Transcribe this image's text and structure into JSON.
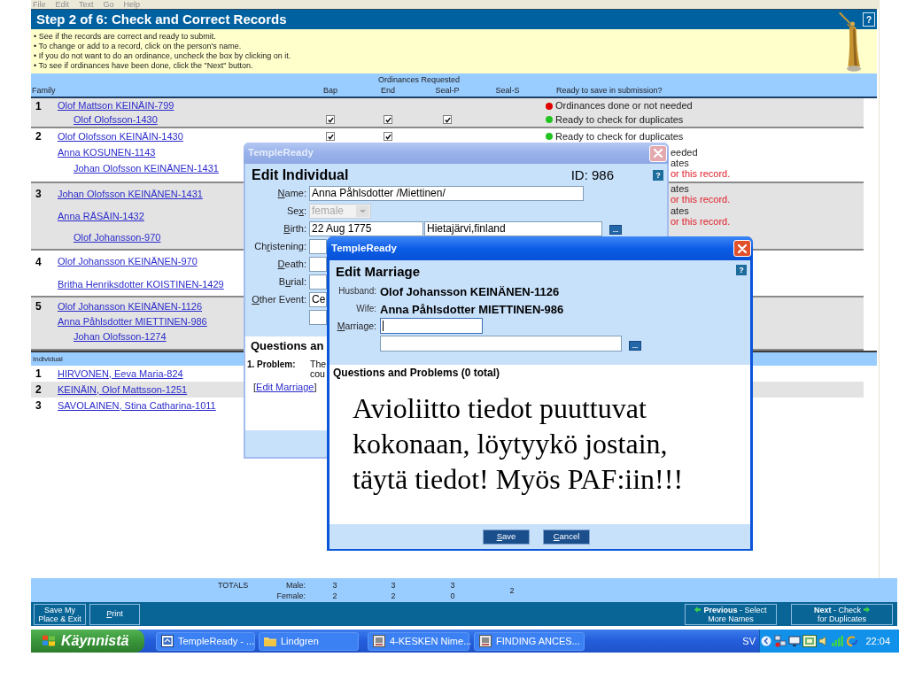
{
  "menu": [
    "File",
    "Edit",
    "Text",
    "Go",
    "Help"
  ],
  "page_header": {
    "title": "Step 2 of 6: Check and Correct Records",
    "help": "?"
  },
  "instructions": [
    "• See if the records are correct and ready to submit.",
    "• To change or add to a record, click on the person's name.",
    "• If you do not want to do an ordinance, uncheck the box by clicking on it.",
    "• To see if ordinances have been done, click the \"Next\" button."
  ],
  "table": {
    "group_label": "Ordinances Requested",
    "columns": [
      "Family",
      "Bap",
      "End",
      "Seal-P",
      "Seal-S",
      "Ready to save in submission?"
    ],
    "families": [
      {
        "number": "1",
        "members": [
          {
            "name": "Olof Mattson KEINÄIN-799",
            "kind": "parent",
            "status": {
              "text": "Ordinances done or not needed",
              "color": "#e00000"
            }
          },
          {
            "name": "Olof Olofsson-1430",
            "kind": "child",
            "ordinances": [
              {
                "checked": true
              },
              {
                "checked": true
              },
              {
                "checked": true
              }
            ],
            "status": {
              "text": "Ready to check for duplicates",
              "color": "#22c422"
            }
          }
        ]
      },
      {
        "number": "2",
        "members": [
          {
            "name": "Olof Olofsson KEINÄIN-1430",
            "kind": "parent",
            "ordinances": [
              {
                "checked": true
              },
              {
                "checked": true
              }
            ],
            "status": {
              "text": "Ready to check for duplicates",
              "color": "#22c422"
            }
          },
          {
            "name": "Anna KOSUNEN-1143",
            "kind": "parent",
            "status": {
              "text": "eeded"
            }
          },
          {
            "name": "Johan Olofsson KEINÄNEN-1431",
            "kind": "child",
            "status": {
              "text": "ates",
              "note": "or this record."
            }
          }
        ]
      },
      {
        "number": "3",
        "members": [
          {
            "name": "Johan Olofsson KEINÄNEN-1431",
            "kind": "parent",
            "status": {
              "text": "ates",
              "note": "or this record."
            }
          },
          {
            "name": "Anna RÄSÄIN-1432",
            "kind": "parent",
            "status": {
              "text": "ates",
              "note": "or this record."
            }
          },
          {
            "name": "Olof Johansson-970",
            "kind": "child"
          }
        ]
      },
      {
        "number": "4",
        "members": [
          {
            "name": "Olof Johansson KEINÄNEN-970",
            "kind": "parent"
          },
          {
            "name": "Britha Henriksdotter KOISTINEN-1429",
            "kind": "parent"
          }
        ]
      },
      {
        "number": "5",
        "members": [
          {
            "name": "Olof Johansson KEINÄNEN-1126",
            "kind": "parent"
          },
          {
            "name": "Anna Påhlsdotter MIETTINEN-986",
            "kind": "parent"
          },
          {
            "name": "Johan Olofsson-1274",
            "kind": "child"
          }
        ]
      }
    ]
  },
  "individuals": {
    "label": "Individual",
    "rows": [
      {
        "number": "1",
        "name": "HIRVONEN, Eeva Maria-824"
      },
      {
        "number": "2",
        "name": "KEINÄIN, Olof Mattsson-1251"
      },
      {
        "number": "3",
        "name": "SAVOLAINEN, Stina Catharina-1011"
      }
    ]
  },
  "totals": {
    "label": "TOTALS",
    "rows": [
      {
        "label": "Male:",
        "values": [
          "3",
          "3",
          "3"
        ]
      },
      {
        "label": "Female:",
        "values": [
          "2",
          "2",
          "0"
        ]
      }
    ],
    "seal_s": "2"
  },
  "buttons": {
    "left": [
      {
        "kind": "stacked",
        "lines": [
          "Save My",
          "Place & Exit"
        ]
      },
      {
        "kind": "single",
        "label": {
          "key": "P",
          "rest": "rint"
        }
      }
    ],
    "right": [
      {
        "kind": "previous",
        "lines": [
          "**Previous** - Select",
          "More Names"
        ]
      },
      {
        "kind": "next",
        "lines": [
          "**Next** - Check",
          "for Duplicates"
        ]
      }
    ]
  },
  "edit_individual": {
    "window_title": "TempleReady",
    "active": false,
    "heading": "Edit Individual",
    "id": "ID: 986",
    "help": "?",
    "fields": [
      {
        "kind": "text",
        "label": {
          "key": "N",
          "rest": "ame:"
        },
        "value": "Anna Påhlsdotter /Miettinen/"
      },
      {
        "kind": "select",
        "label": {
          "pre": "Se",
          "key": "x",
          "rest": ":"
        },
        "value": "female",
        "disabled": true
      },
      {
        "kind": "date_place",
        "label": {
          "key": "B",
          "rest": "irth:"
        },
        "values": [
          "22 Aug 1775",
          "Hietajärvi,finland"
        ],
        "more": "..."
      },
      {
        "kind": "cut",
        "label": {
          "pre": "Ch",
          "key": "r",
          "rest": "istening:"
        }
      },
      {
        "kind": "cut",
        "label": {
          "key": "D",
          "rest": "eath:"
        }
      },
      {
        "kind": "cut",
        "label": {
          "pre": "B",
          "key": "u",
          "rest": "rial:"
        }
      },
      {
        "kind": "cut",
        "label": {
          "key": "O",
          "rest": "ther Event:"
        },
        "value": "Ce"
      },
      {
        "kind": "cut"
      }
    ],
    "questions_heading": "Questions an",
    "problem": {
      "label": "1. Problem:",
      "lines": [
        "The",
        "cou"
      ]
    },
    "edit_link": {
      "prefix": "[",
      "label": "Edit Marriage",
      "suffix": "]"
    }
  },
  "edit_marriage": {
    "window_title": "TempleReady",
    "active": true,
    "heading": "Edit Marriage",
    "help": "?",
    "husband": {
      "label": "Husband:",
      "value": "Olof Johansson KEINÄNEN-1126"
    },
    "wife": {
      "label": "Wife:",
      "value": "Anna Påhlsdotter MIETTINEN-986"
    },
    "marriage": {
      "label": {
        "key": "M",
        "rest": "arriage:"
      },
      "inputs": [
        {
          "focused": true
        },
        {
          "focused": false
        }
      ],
      "more": "..."
    },
    "questions_heading": "Questions and Problems (0 total)",
    "note_lines": [
      "Avioliitto tiedot puuttuvat",
      "kokonaan, löytyykö jostain,",
      "täytä tiedot! Myös PAF:iin!!!"
    ],
    "buttons": [
      {
        "key": "S",
        "rest": "ave"
      },
      {
        "key": "C",
        "rest": "ancel"
      }
    ]
  },
  "taskbar": {
    "start": "Käynnistä",
    "tasks": [
      {
        "kind": "app",
        "label": "TempleReady - ..."
      },
      {
        "kind": "folder",
        "label": "Lindgren"
      },
      {
        "kind": "document",
        "label": "4-KESKEN Nime..."
      },
      {
        "kind": "document",
        "label": "FINDING ANCES..."
      }
    ],
    "language": "SV",
    "clock": "22:04"
  }
}
